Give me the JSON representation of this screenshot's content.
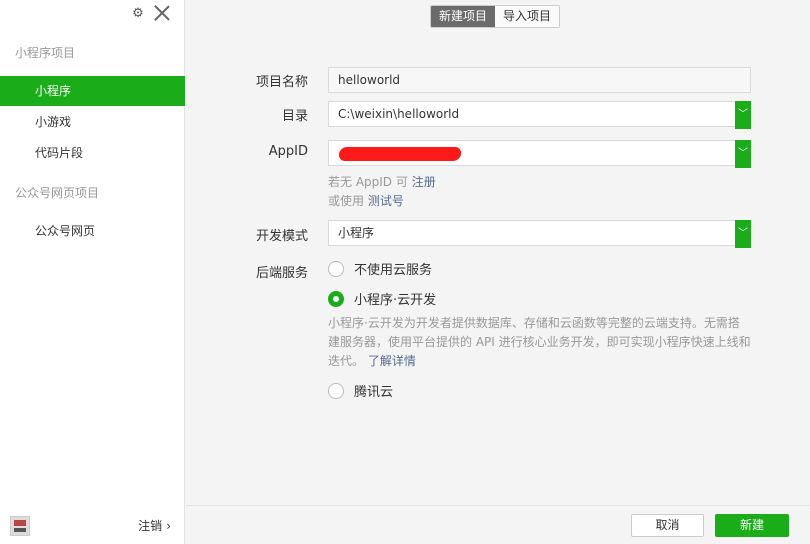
{
  "sidebar": {
    "section_miniprogram": "小程序项目",
    "items": [
      {
        "label": "小程序"
      },
      {
        "label": "小游戏"
      },
      {
        "label": "代码片段"
      }
    ],
    "section_official": "公众号网页项目",
    "official_item": "公众号网页",
    "logout_label": "注销",
    "logout_arrow": "›"
  },
  "header": {
    "tabs": [
      {
        "label": "新建项目"
      },
      {
        "label": "导入项目"
      }
    ]
  },
  "form": {
    "project_name_label": "项目名称",
    "project_name_value": "helloworld",
    "directory_label": "目录",
    "directory_value": "C:\\weixin\\helloworld",
    "appid_label": "AppID",
    "hint_prefix": "若无 AppID 可",
    "hint_register": "注册",
    "hint_or": "或使用",
    "hint_test": "测试号",
    "mode_label": "开发模式",
    "mode_value": "小程序",
    "backend_label": "后端服务",
    "options": [
      {
        "label": "不使用云服务"
      },
      {
        "label": "小程序·云开发"
      },
      {
        "label": "腾讯云"
      }
    ],
    "cloud_desc_line1": "小程序·云开发为开发者提供数据库、存储和云函数等完整的云端支持。无需搭",
    "cloud_desc_line2": "建服务器，使用平台提供的 API 进行核心业务开发，即可实现小程序快速上线和",
    "cloud_desc_line3": "迭代。",
    "learn_more": "了解详情"
  },
  "footer": {
    "cancel_label": "取消",
    "create_label": "新建"
  },
  "colors": {
    "accent": "#1aad19",
    "link": "#576b95"
  }
}
